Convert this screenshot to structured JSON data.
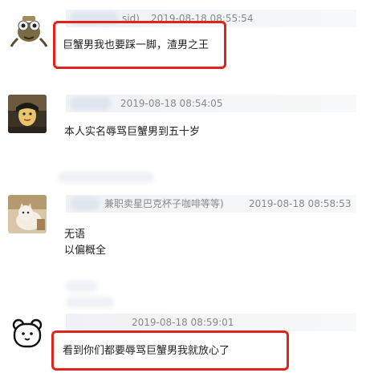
{
  "comments": [
    {
      "id_fragment": "sid)",
      "timestamp": "2019-08-18 08:55:54",
      "text": "巨蟹男我也要踩一脚，渣男之王"
    },
    {
      "timestamp": "2019-08-18 08:54:05",
      "text": "本人实名辱骂巨蟹男到五十岁"
    },
    {
      "username_suffix": "兼职卖星巴克杯子咖啡等等)",
      "timestamp": "2019-08-18 08:58:53",
      "text_lines": [
        "无语",
        "以偏概全"
      ]
    },
    {
      "timestamp": "2019-08-18 08:59:01",
      "text": "看到你们都要辱骂巨蟹男我就放心了"
    }
  ],
  "colors": {
    "highlight": "#e0231d",
    "meta_text": "#888888",
    "body_text": "#222222"
  },
  "icons": [
    "frog-mascot-avatar",
    "girl-photo-avatar",
    "cat-photo-avatar",
    "bear-face-avatar"
  ]
}
